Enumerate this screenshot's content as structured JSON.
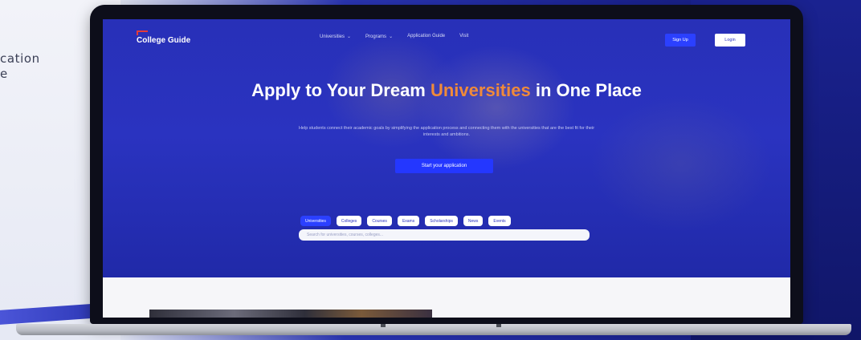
{
  "background": {
    "left_text": [
      "cation",
      "e"
    ],
    "colors": {
      "left_bg": "#e9ebf5",
      "right_bg": "#1b2391"
    }
  },
  "app": {
    "logo": {
      "mark": "",
      "name": "College Guide"
    },
    "nav": {
      "links": [
        {
          "label": "Universities",
          "has_dropdown": true
        },
        {
          "label": "Programs",
          "has_dropdown": true
        },
        {
          "label": "Application Guide",
          "has_dropdown": false
        },
        {
          "label": "Visit",
          "has_dropdown": false
        }
      ],
      "signup_label": "Sign Up",
      "login_label": "Login"
    },
    "hero": {
      "title_part1": "Apply to Your Dream ",
      "title_accent": "Universities",
      "title_part2": " in One Place",
      "subtitle": "Help students connect their academic goals by simplifying the application process and connecting them with the universities that are the best fit for their interests and ambitions.",
      "cta_label": "Start your application",
      "chips": [
        {
          "label": "Universities",
          "active": true
        },
        {
          "label": "Colleges",
          "active": false
        },
        {
          "label": "Courses",
          "active": false
        },
        {
          "label": "Exams",
          "active": false
        },
        {
          "label": "Scholarships",
          "active": false
        },
        {
          "label": "News",
          "active": false
        },
        {
          "label": "Events",
          "active": false
        }
      ],
      "search_placeholder": "Search for universities, courses, colleges..."
    },
    "colors": {
      "hero_bg": "#2a33c0",
      "accent": "#f08a3a",
      "primary_button": "#2b40ff"
    }
  }
}
